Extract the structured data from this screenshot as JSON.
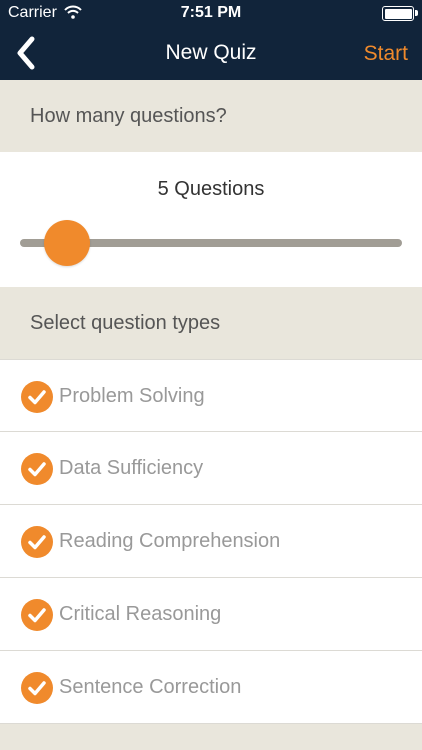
{
  "status_bar": {
    "carrier": "Carrier",
    "time": "7:51 PM"
  },
  "nav": {
    "title": "New Quiz",
    "start_label": "Start",
    "accent": "#f08a2c",
    "background": "#11243a"
  },
  "questions_section": {
    "header": "How many questions?",
    "count_label": "5 Questions",
    "slider_fraction": 0.05
  },
  "types_section": {
    "header": "Select question types",
    "items": [
      {
        "label": "Problem Solving",
        "checked": true
      },
      {
        "label": "Data Sufficiency",
        "checked": true
      },
      {
        "label": "Reading Comprehension",
        "checked": true
      },
      {
        "label": "Critical Reasoning",
        "checked": true
      },
      {
        "label": "Sentence Correction",
        "checked": true
      }
    ]
  }
}
